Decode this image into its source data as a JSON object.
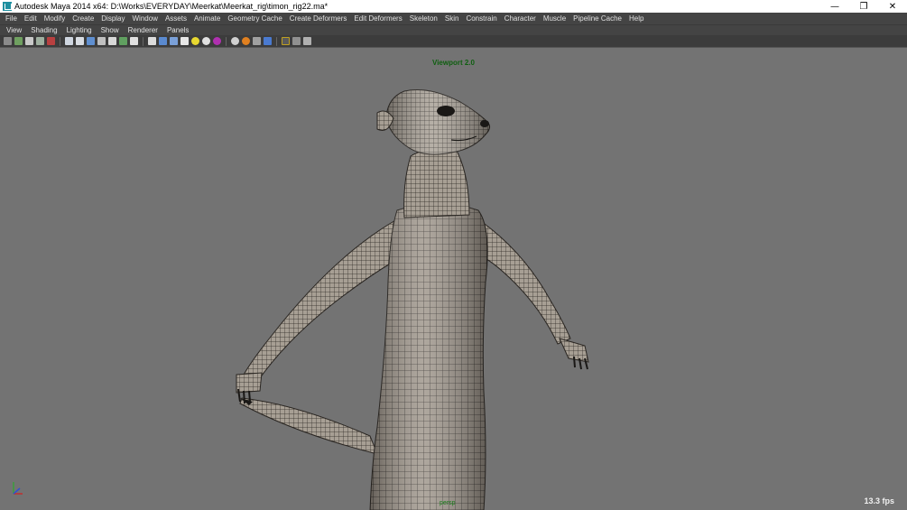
{
  "window": {
    "title": "Autodesk Maya 2014 x64: D:\\Works\\EVERYDAY\\Meerkat\\Meerkat_rig\\timon_rig22.ma*",
    "minimize_glyph": "—",
    "restore_glyph": "❐",
    "close_glyph": "✕"
  },
  "menubar": {
    "items": [
      "File",
      "Edit",
      "Modify",
      "Create",
      "Display",
      "Window",
      "Assets",
      "Animate",
      "Geometry Cache",
      "Create Deformers",
      "Edit Deformers",
      "Skeleton",
      "Skin",
      "Constrain",
      "Character",
      "Muscle",
      "Pipeline Cache",
      "Help"
    ]
  },
  "panel_menu": {
    "items": [
      "View",
      "Shading",
      "Lighting",
      "Show",
      "Renderer",
      "Panels"
    ]
  },
  "toolbar": {
    "icons": [
      "select-camera-icon",
      "camera-attributes-icon",
      "bookmark-icon",
      "image-plane-icon",
      "film-gate-icon",
      "grid-icon",
      "wireframe-icon",
      "smooth-shade-icon",
      "textured-icon",
      "lights-icon",
      "shadows-icon",
      "xray-icon",
      "isolate-select-icon",
      "ambient-occlusion-icon",
      "motion-blur-icon",
      "anti-alias-icon",
      "depth-of-field-icon"
    ]
  },
  "viewport": {
    "renderer_label": "Viewport 2.0",
    "fps": "13.3 fps",
    "camera_label": "persp",
    "background_color": "#737373",
    "label_color": "#0f5f10"
  }
}
